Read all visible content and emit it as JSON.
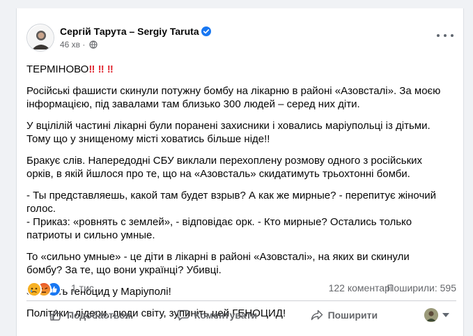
{
  "post": {
    "author": "Сергій Тарута – Sergiy Taruta",
    "time": "46 хв",
    "time_separator": "·",
    "headline": "ТЕРМІНОВО",
    "headline_marks": "‼ ‼ ‼",
    "paragraphs": [
      "Російські фашисти скинули потужну бомбу на лікарню в районі «Азовсталі». За моєю інформацією, під завалами там близько 300 людей – серед них діти.",
      "У вцілілій частині лікарні були поранені захисники і ховались маріупольці із дітьми. Тому що у знищеному місті ховатись більше ніде!!",
      "Бракує слів. Напередодні СБУ виклали перехоплену розмову одного з російських орків, в якій йшлося про те, що на «Азовсталь» скидатимуть трьохтонні бомби."
    ],
    "dialogue": [
      "- Ты представляешь, какой там будет взрыв? А как же мирные? - перепитує жіночий голос.",
      "- Приказ: «ровнять с землей», - відповідає орк. - Кто мирные? Остались только патриоты и сильно умные."
    ],
    "closing": [
      "То «сильно умные» - це діти в лікарні в районі «Азовсталі», на яких ви скинули бомбу? За те, що вони українці? Убивці.",
      "Зупиніть геноцид у Маріуполі!",
      "Політики, лідери, люди світу, зупиніть цей ГЕНОЦИД!"
    ]
  },
  "stats": {
    "reactions": "1 тис.",
    "comments": "122 коментарі",
    "shares": "Поширили: 595"
  },
  "actions": {
    "like": "Подобається",
    "comment": "Коментувати",
    "share": "Поширити"
  },
  "colors": {
    "accent": "#1877f2",
    "exclamation": "#e02a33",
    "muted": "#65676b"
  },
  "icons": {
    "verified": "verified-badge-icon",
    "privacy": "globe-icon",
    "more": "more-options-icon",
    "reactions": [
      "sad-reaction-icon",
      "angry-reaction-icon",
      "like-reaction-icon"
    ],
    "like": "thumbs-up-icon",
    "comment": "speech-bubble-icon",
    "share": "share-arrow-icon"
  }
}
